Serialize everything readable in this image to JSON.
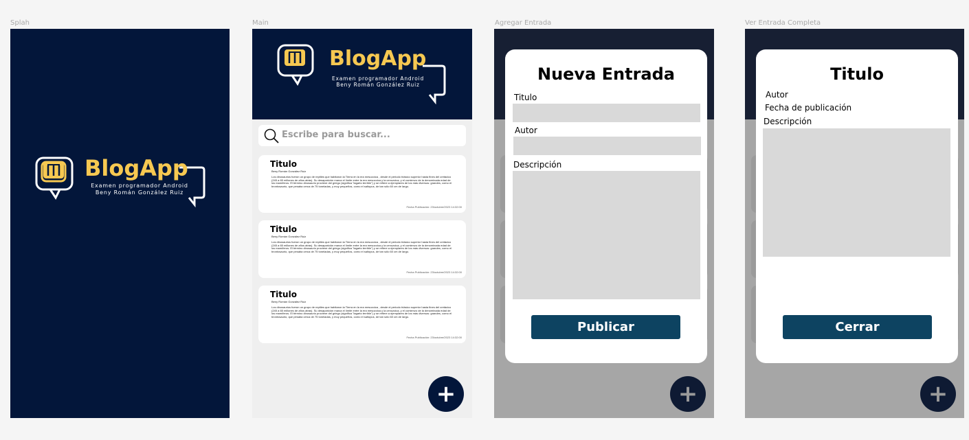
{
  "frames": {
    "splash": "Splah",
    "main": "Main",
    "add": "Agregar Entrada",
    "view": "Ver Entrada Completa"
  },
  "brand": {
    "name": "BlogApp",
    "line1": "Examen programador Android",
    "line2": "Beny Román González Ruiz",
    "accent": "#f6c851",
    "background": "#03163a"
  },
  "search": {
    "placeholder": "Escribe para buscar..."
  },
  "cards": [
    {
      "title": "Titulo",
      "author": "Beny Román González Ruiz",
      "body": "Los dinosaurios fueron un grupo de reptiles que habitaron la Tierra en la era mesozoica , desde el periodo triásico superior hasta fines del cretácico (245 a 65 millones de años atrás). Su desaparición marca el límite entre la era mesozoica y la cenozoica, y el comienzo de la denominada edad de los mamíferos. El término dinosaurio proviene del griego (significa \"lagarto terrible\") y se refiere a ejemplares de los más diversos: grandes, como el brontosaurio, que pesaba cerca de 75 toneladas, y muy pequeños, como el saltopus, de tan sólo 60 cm de largo.",
      "date": "Fecha Publicación: 23/octubre/2023 14:32:00"
    },
    {
      "title": "Titulo",
      "author": "Beny Román González Ruiz",
      "body": "Los dinosaurios fueron un grupo de reptiles que habitaron la Tierra en la era mesozoica , desde el periodo triásico superior hasta fines del cretácico (245 a 65 millones de años atrás). Su desaparición marca el límite entre la era mesozoica y la cenozoica, y el comienzo de la denominada edad de los mamíferos. El término dinosaurio proviene del griego (significa \"lagarto terrible\") y se refiere a ejemplares de los más diversos: grandes, como el brontosaurio, que pesaba cerca de 75 toneladas, y muy pequeños, como el saltopus, de tan sólo 60 cm de largo.",
      "date": "Fecha Publicación: 23/octubre/2023 14:32:00"
    },
    {
      "title": "Titulo",
      "author": "Beny Román González Ruiz",
      "body": "Los dinosaurios fueron un grupo de reptiles que habitaron la Tierra en la era mesozoica , desde el periodo triásico superior hasta fines del cretácico (245 a 65 millones de años atrás). Su desaparición marca el límite entre la era mesozoica y la cenozoica, y el comienzo de la denominada edad de los mamíferos. El término dinosaurio proviene del griego (significa \"lagarto terrible\") y se refiere a ejemplares de los más diversos: grandes, como el brontosaurio, que pesaba cerca de 75 toneladas, y muy pequeños, como el saltopus, de tan sólo 60 cm de largo.",
      "date": "Fecha Publicación: 23/octubre/2023 14:32:00"
    }
  ],
  "fab": {
    "icon": "plus-icon",
    "symbol": "+"
  },
  "add_modal": {
    "title": "Nueva Entrada",
    "title_label": "Titulo",
    "author_label": "Autor",
    "desc_label": "Descripción",
    "button": "Publicar"
  },
  "view_modal": {
    "title": "Titulo",
    "author_label": "Autor",
    "date_label": "Fecha de publicación",
    "desc_label": "Descripción",
    "button": "Cerrar"
  },
  "colors": {
    "navy": "#03163a",
    "button": "#0d4361",
    "overlay": "#a6a6a6"
  }
}
